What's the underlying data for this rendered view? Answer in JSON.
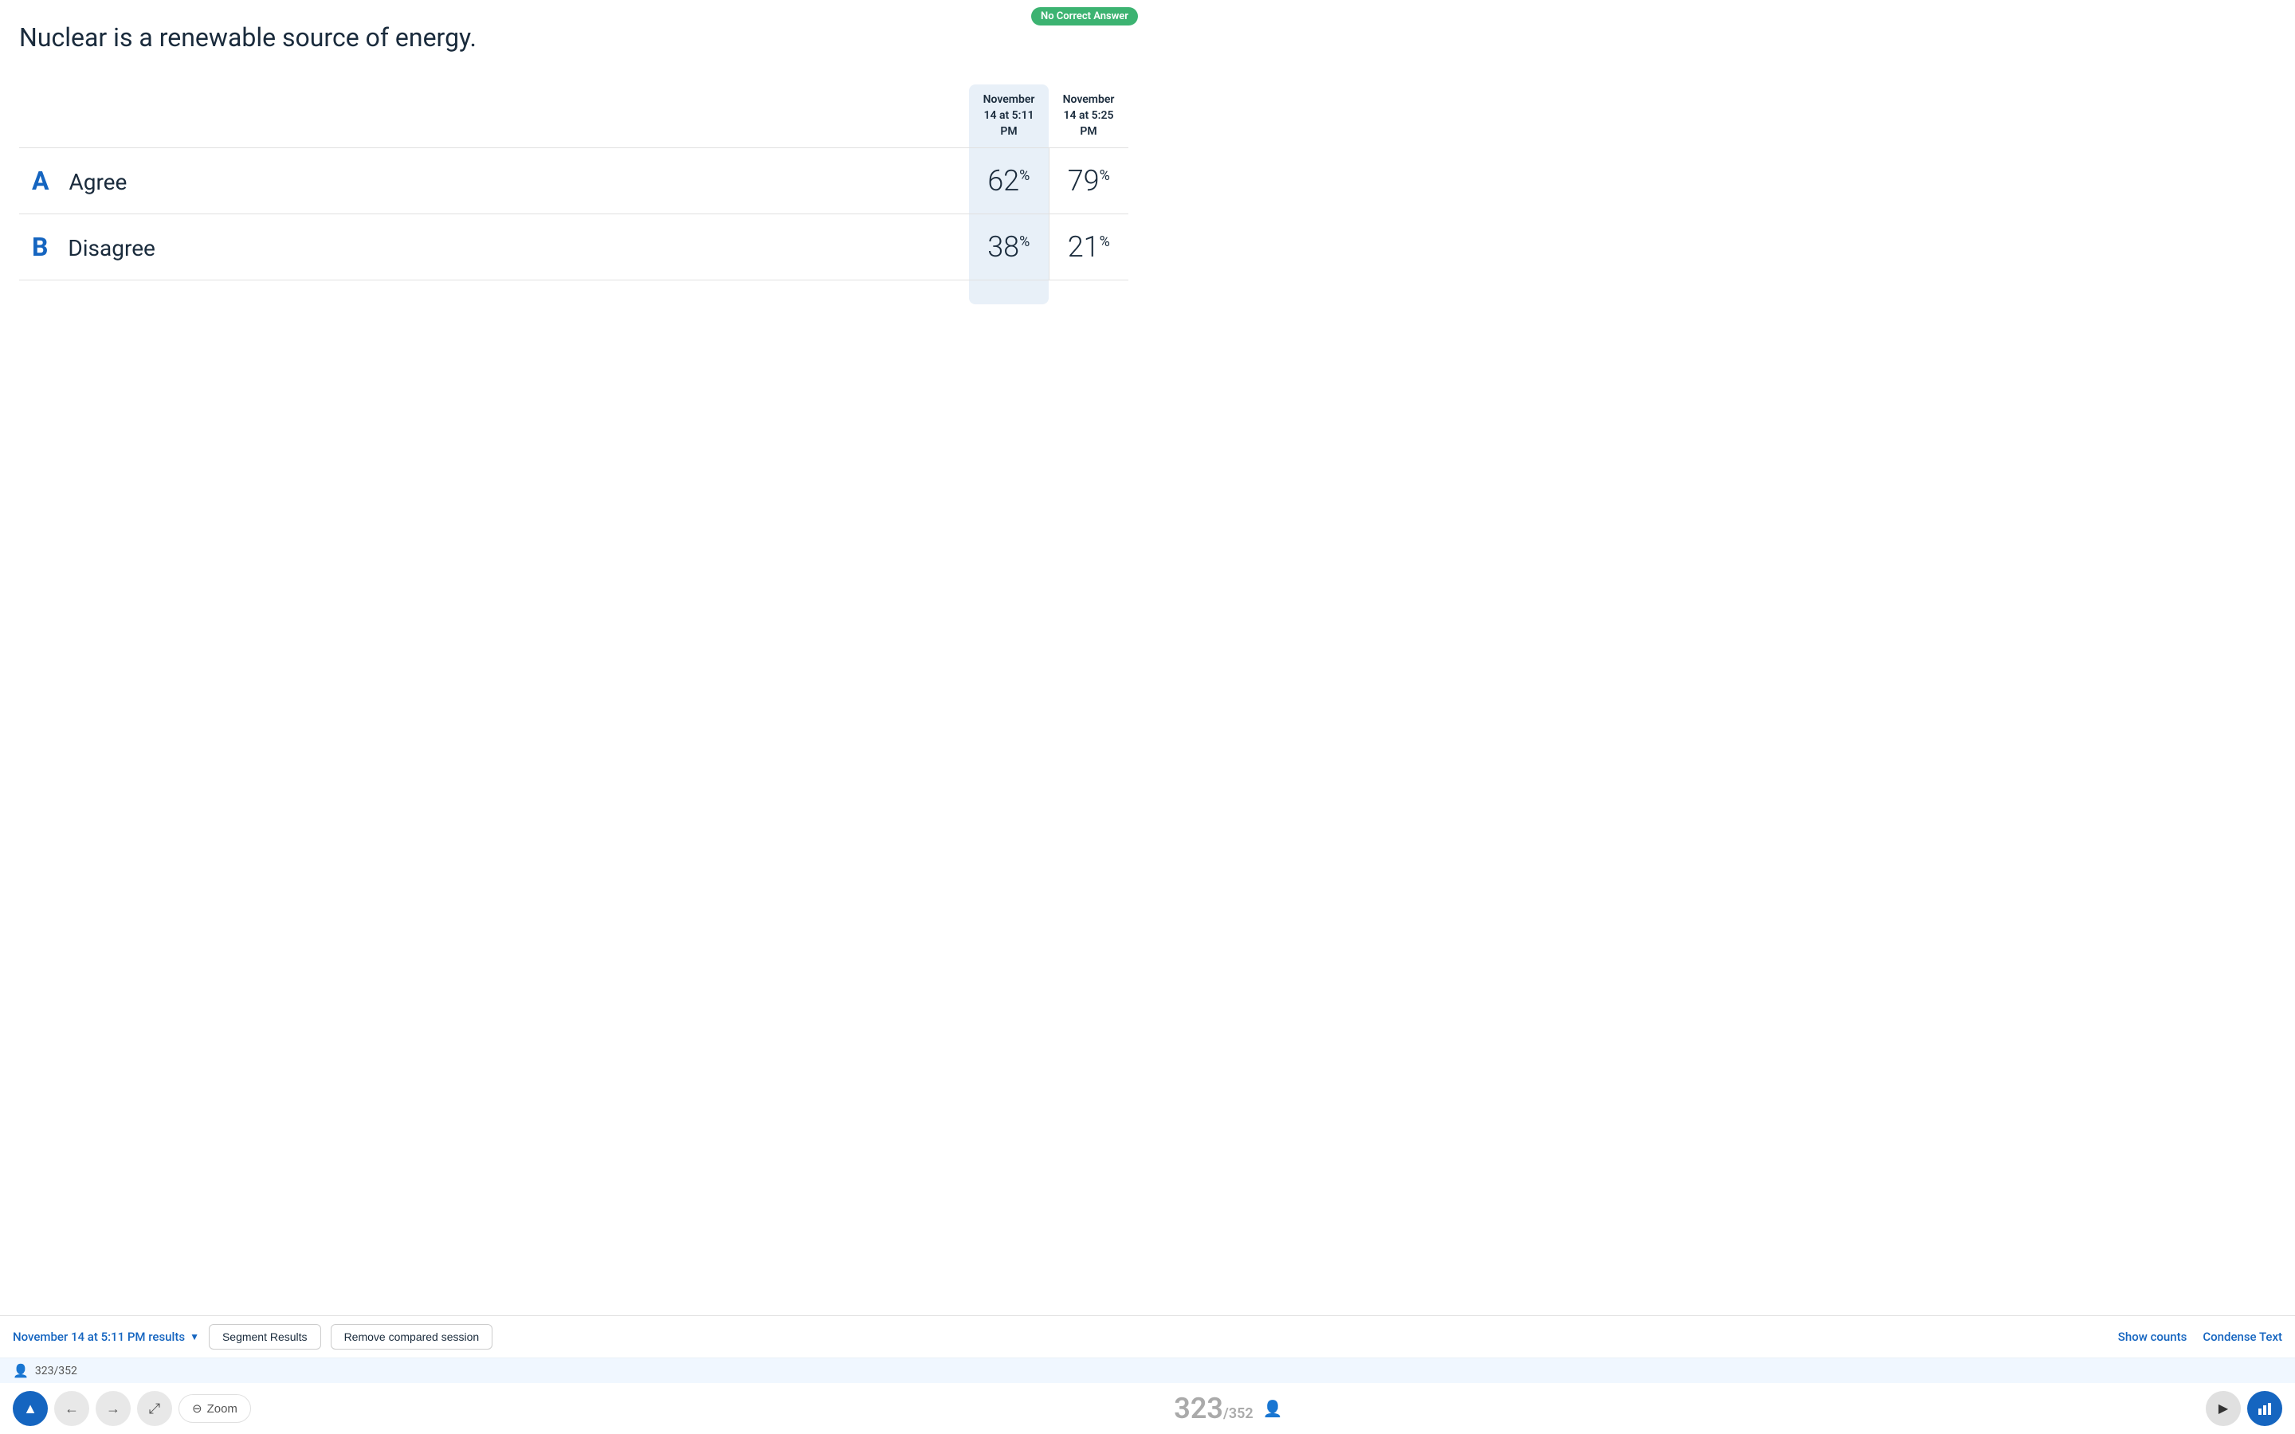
{
  "badge": {
    "label": "No Correct Answer",
    "color": "#3cb371"
  },
  "question": {
    "text": "Nuclear is a renewable source of energy."
  },
  "sessions": {
    "col1": {
      "label": "November 14 at 5:11 PM",
      "highlighted": true
    },
    "col2": {
      "label": "November 14 at 5:25 PM",
      "highlighted": false
    }
  },
  "answers": [
    {
      "letter": "A",
      "text": "Agree",
      "val1": "62",
      "val2": "79"
    },
    {
      "letter": "B",
      "text": "Disagree",
      "val1": "38",
      "val2": "21"
    }
  ],
  "toolbar": {
    "session_label": "November 14 at 5:11 PM results",
    "segment_btn": "Segment Results",
    "remove_btn": "Remove compared session",
    "show_counts": "Show counts",
    "condense_text": "Condense Text"
  },
  "stats": {
    "current": "323",
    "total": "352",
    "display": "323/352"
  },
  "controls": {
    "zoom_label": "Zoom",
    "up_icon": "▲",
    "back_icon": "←",
    "forward_icon": "→",
    "move_icon": "⤢",
    "zoom_icon": "⊖",
    "play_icon": "▶",
    "chart_icon": "📊"
  }
}
